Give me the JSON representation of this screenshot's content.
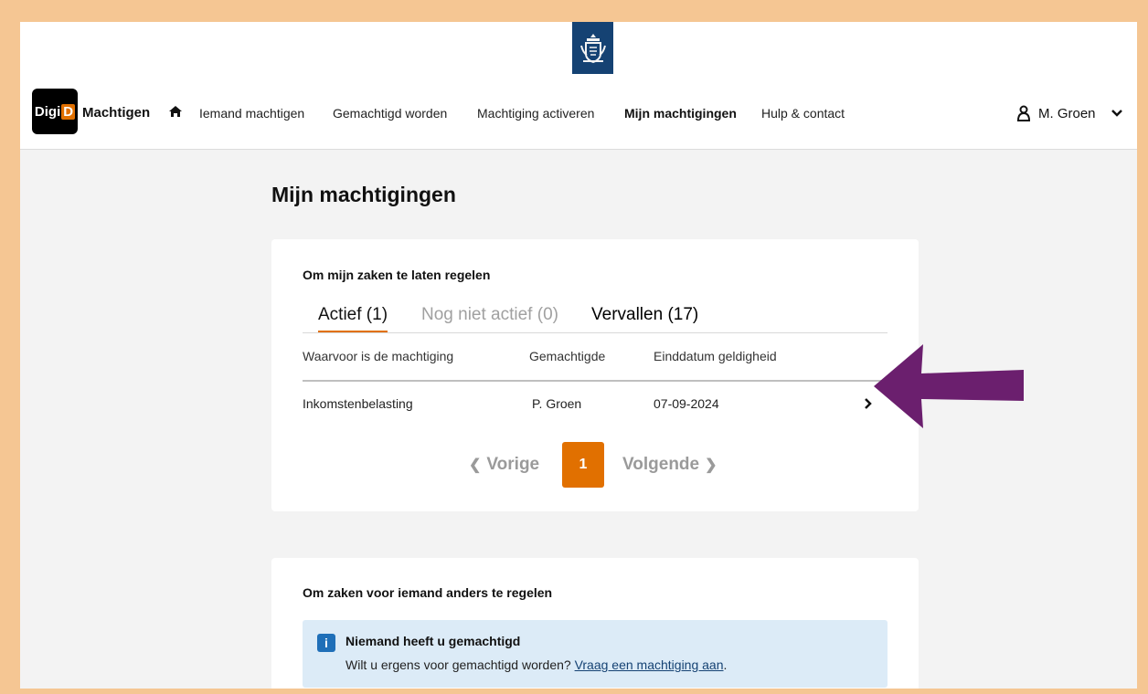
{
  "header": {
    "brand_logo": "DigiD",
    "logo_part1": "Digi",
    "logo_part2": "D",
    "app_name": "Machtigen",
    "nav": [
      {
        "label": "Iemand machtigen",
        "active": false
      },
      {
        "label": "Gemachtigd worden",
        "active": false
      },
      {
        "label": "Machtiging activeren",
        "active": false
      },
      {
        "label": "Mijn machtigingen",
        "active": true
      },
      {
        "label": "Hulp & contact",
        "active": false
      }
    ],
    "user_name": "M. Groen"
  },
  "page_title": "Mijn machtigingen",
  "section1": {
    "title": "Om mijn zaken te laten regelen",
    "tabs": [
      {
        "label": "Actief (1)",
        "state": "active"
      },
      {
        "label": "Nog niet actief (0)",
        "state": "disabled"
      },
      {
        "label": "Vervallen (17)",
        "state": "normal"
      }
    ],
    "columns": [
      "Waarvoor is de machtiging",
      "Gemachtigde",
      "Einddatum geldigheid"
    ],
    "rows": [
      {
        "purpose": "Inkomstenbelasting",
        "delegate": "P. Groen",
        "end_date": "07-09-2024"
      }
    ],
    "pagination": {
      "prev_label": "Vorige",
      "current_page": "1",
      "next_label": "Volgende"
    }
  },
  "section2": {
    "title": "Om zaken voor iemand anders te regelen",
    "info_icon_label": "i",
    "info_title": "Niemand heeft u gemachtigd",
    "info_text": "Wilt u ergens voor gemachtigd worden?",
    "info_link": "Vraag een machtiging aan",
    "info_text_end": "."
  },
  "colors": {
    "accent": "#e17000",
    "frame": "#f5c693",
    "arrow": "#6b1f6e",
    "crest": "#154273",
    "info_bg": "#dcebf7"
  }
}
